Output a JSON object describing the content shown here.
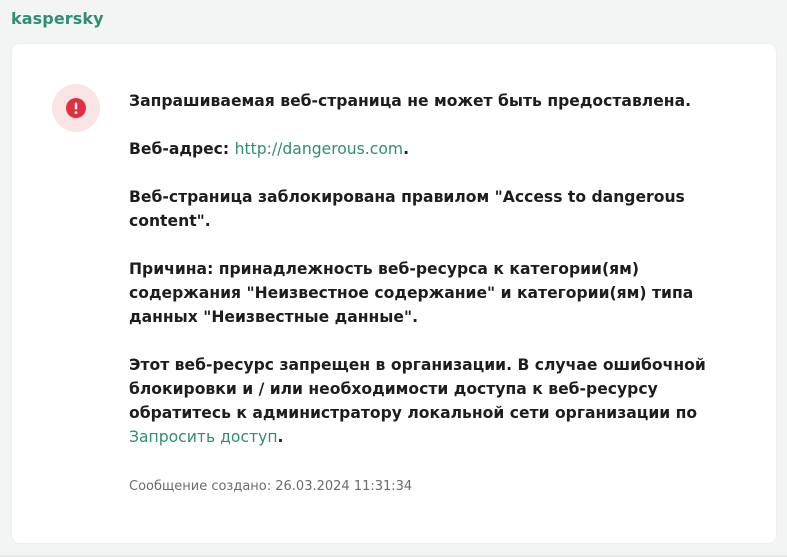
{
  "header": {
    "logo_text": "kaspersky"
  },
  "message": {
    "title": "Запрашиваемая веб-страница не может быть предоставлена.",
    "address_label": "Веб-адрес: ",
    "address_link": "http://dangerous.com",
    "address_suffix": ".",
    "rule_text": "Веб-страница заблокирована правилом \"Access to dangerous content\".",
    "reason_text": "Причина: принадлежность веб-ресурса к категории(ям) содержания \"Неизвестное содержание\" и категории(ям) типа данных \"Неизвестные данные\".",
    "policy_text": "Этот веб-ресурс запрещен в организации. В случае ошибочной блокировки и / или необходимости доступа к веб-ресурсу обратитесь к администратору локальной сети организации по ",
    "request_link": "Запросить доступ",
    "policy_suffix": ".",
    "timestamp": "Сообщение создано: 26.03.2024 11:31:34"
  },
  "icons": {
    "alert": "alert-circle-icon"
  },
  "colors": {
    "brand": "#2f8e74",
    "alert": "#e0303f",
    "alert_bg": "#fbe4e6"
  }
}
